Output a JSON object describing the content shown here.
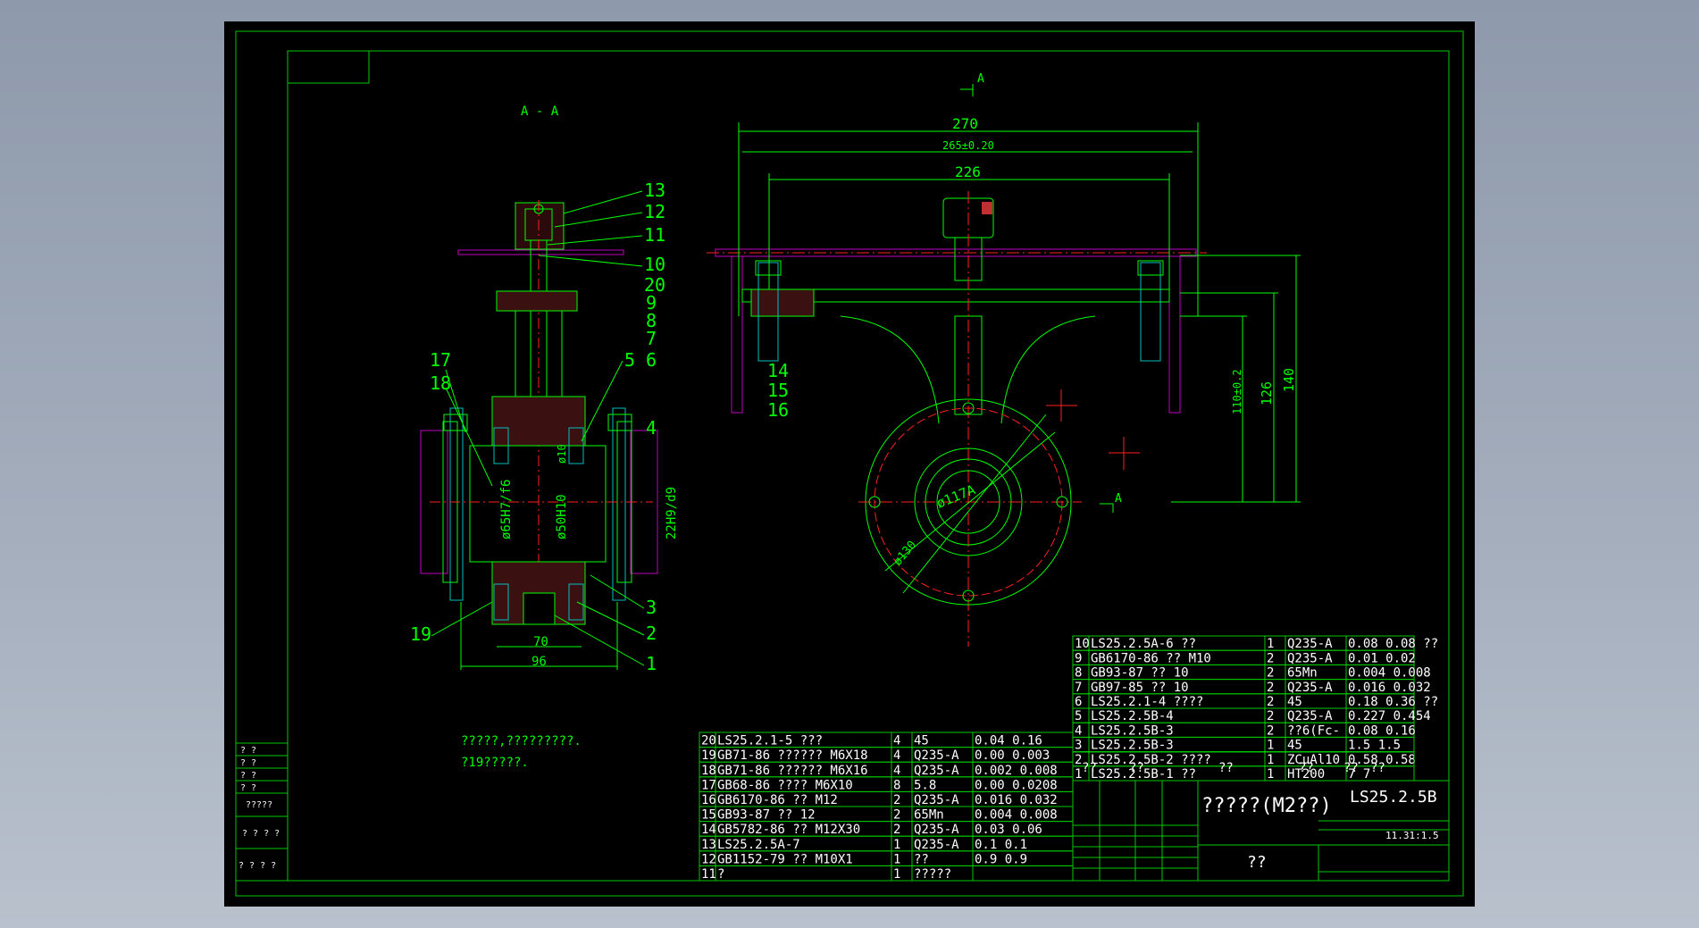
{
  "colors": {
    "background": "#000000",
    "frame": "#00c800",
    "outline": "#00ff00",
    "text_green": "#00ff00",
    "text_white": "#ffffff",
    "magenta": "#c000c0",
    "red_center": "#ff2020",
    "hatch": "#c03030",
    "cyan": "#00c0c0",
    "yellow": "#ffff00"
  },
  "views": {
    "section_label": "A - A",
    "cut_marker_top": "A",
    "cut_marker_right": "A",
    "callouts": [
      "13",
      "12",
      "11",
      "10",
      "20",
      "9",
      "8",
      "7",
      "5",
      "6",
      "17",
      "18",
      "4",
      "3",
      "2",
      "1",
      "19",
      "14",
      "15",
      "16"
    ]
  },
  "dimensions": {
    "d270": "270",
    "d265": "265±0.20",
    "d226": "226",
    "d140": "140",
    "d126": "126",
    "d110": "110±0.2",
    "d70": "70",
    "d96": "96",
    "d65": "ø65H7/f6",
    "d50": "ø50H10",
    "d22": "22H9/d9",
    "d117": "ø117A",
    "d130": "ø130",
    "d10": "ø10"
  },
  "notes": {
    "line1": "?????,?????????.",
    "line2": "?19?????."
  },
  "bom_right": [
    {
      "no": "10",
      "code": "LS25.2.5A-6",
      "name": "??",
      "qty": "1",
      "mat": "Q235-A",
      "w": "0.08 0.08 ??"
    },
    {
      "no": "9",
      "code": "GB6170-86",
      "name": "?? M10",
      "qty": "2",
      "mat": "Q235-A",
      "w": "0.01 0.02"
    },
    {
      "no": "8",
      "code": "GB93-87",
      "name": "?? 10",
      "qty": "2",
      "mat": "65Mn",
      "w": "0.004 0.008"
    },
    {
      "no": "7",
      "code": "GB97-85",
      "name": "?? 10",
      "qty": "2",
      "mat": "Q235-A",
      "w": "0.016 0.032"
    },
    {
      "no": "6",
      "code": "LS25.2.1-4",
      "name": "????",
      "qty": "2",
      "mat": "45",
      "w": "0.18 0.36 ??"
    },
    {
      "no": "5",
      "code": "LS25.2.5B-4",
      "name": "",
      "qty": "2",
      "mat": "Q235-A",
      "w": "0.227 0.454"
    },
    {
      "no": "4",
      "code": "LS25.2.5B-3",
      "name": "",
      "qty": "2",
      "mat": "??6(Fc-",
      "w": "0.08 0.16"
    },
    {
      "no": "3",
      "code": "LS25.2.5B-3",
      "name": "",
      "qty": "1",
      "mat": "45",
      "w": "1.5 1.5"
    },
    {
      "no": "2",
      "code": "LS25.2.5B-2",
      "name": "????",
      "qty": "1",
      "mat": "ZCuAl10",
      "w": "0.58 0.58"
    },
    {
      "no": "1",
      "code": "LS25.2.5B-1",
      "name": "??",
      "qty": "1",
      "mat": "HT200",
      "w": "7 7"
    }
  ],
  "bom_right_header": [
    "??",
    "??",
    "??",
    "??",
    "??",
    "??"
  ],
  "bom_left": [
    {
      "no": "20",
      "code": "LS25.2.1-5",
      "name": "???",
      "qty": "4",
      "mat": "45",
      "w": "0.04 0.16"
    },
    {
      "no": "19",
      "code": "GB71-86",
      "name": "?????? M6X18",
      "qty": "4",
      "mat": "Q235-A",
      "w": "0.00 0.003"
    },
    {
      "no": "18",
      "code": "GB71-86",
      "name": "?????? M6X16",
      "qty": "4",
      "mat": "Q235-A",
      "w": "0.002 0.008"
    },
    {
      "no": "17",
      "code": "GB68-86",
      "name": "???? M6X10",
      "qty": "8",
      "mat": "5.8",
      "w": "0.00 0.0208"
    },
    {
      "no": "16",
      "code": "GB6170-86",
      "name": "?? M12",
      "qty": "2",
      "mat": "Q235-A",
      "w": "0.016 0.032"
    },
    {
      "no": "15",
      "code": "GB93-87",
      "name": "?? 12",
      "qty": "2",
      "mat": "65Mn",
      "w": "0.004 0.008"
    },
    {
      "no": "14",
      "code": "GB5782-86",
      "name": "?? M12X30",
      "qty": "2",
      "mat": "Q235-A",
      "w": "0.03 0.06"
    },
    {
      "no": "13",
      "code": "LS25.2.5A-7",
      "name": "",
      "qty": "1",
      "mat": "Q235-A",
      "w": "0.1 0.1"
    },
    {
      "no": "12",
      "code": "GB1152-79",
      "name": "?? M10X1",
      "qty": "1",
      "mat": "??",
      "w": "0.9 0.9"
    },
    {
      "no": "11",
      "code": "",
      "name": "?",
      "qty": "1",
      "mat": "?????",
      "w": ""
    }
  ],
  "title_block": {
    "title": "?????(M2??)",
    "drawing_no": "LS25.2.5B",
    "scale": "11.31:1.5",
    "bottom": "??"
  },
  "left_margin_labels": [
    "? ?",
    "? ?",
    "? ?",
    "? ?",
    "?????",
    "? ? ? ?",
    "? ? ?  ?"
  ]
}
